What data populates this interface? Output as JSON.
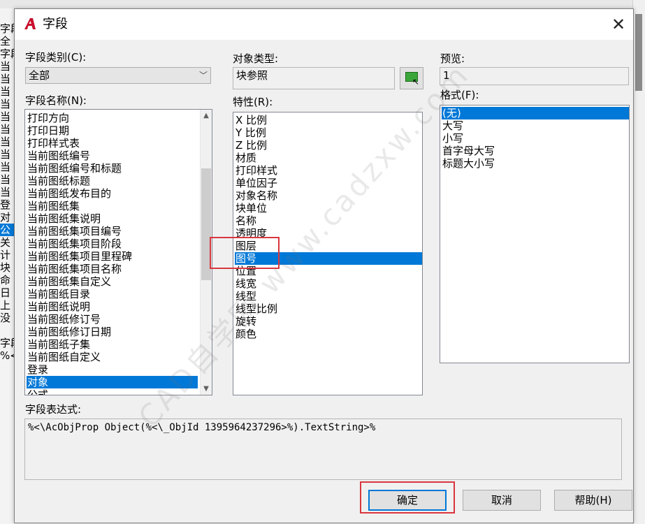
{
  "background_window": {
    "left_items": [
      "字段",
      "全",
      "字段",
      "当",
      "当",
      "当",
      "当",
      "当",
      "当",
      "当",
      "当",
      "当",
      "当",
      "当",
      "登",
      "对",
      "公",
      "关",
      "计",
      "块",
      "命",
      "日",
      "上",
      "没",
      "",
      "字段",
      "%<"
    ],
    "left_selected_index": 16
  },
  "dialog": {
    "title": "字段",
    "close_symbol": "✕",
    "category": {
      "label": "字段类别(C):",
      "value": "全部"
    },
    "field_names": {
      "label": "字段名称(N):",
      "items": [
        "打印方向",
        "打印日期",
        "打印样式表",
        "当前图纸编号",
        "当前图纸编号和标题",
        "当前图纸标题",
        "当前图纸发布目的",
        "当前图纸集",
        "当前图纸集说明",
        "当前图纸集项目编号",
        "当前图纸集项目阶段",
        "当前图纸集项目里程碑",
        "当前图纸集项目名称",
        "当前图纸集自定义",
        "当前图纸目录",
        "当前图纸说明",
        "当前图纸修订号",
        "当前图纸修订日期",
        "当前图纸子集",
        "当前图纸自定义",
        "登录",
        "对象",
        "公式"
      ],
      "selected_index": 21
    },
    "object_type": {
      "label": "对象类型:",
      "value": "块参照"
    },
    "properties": {
      "label": "特性(R):",
      "items": [
        "X 比例",
        "Y 比例",
        "Z 比例",
        "材质",
        "打印样式",
        "单位因子",
        "对象名称",
        "块单位",
        "名称",
        "透明度",
        "图层",
        "图号",
        "位置",
        "线宽",
        "线型",
        "线型比例",
        "旋转",
        "颜色"
      ],
      "selected_index": 11
    },
    "preview": {
      "label": "预览:",
      "value": "1"
    },
    "format": {
      "label": "格式(F):",
      "items": [
        "(无)",
        "大写",
        "小写",
        "首字母大写",
        "标题大小写"
      ],
      "selected_index": 0
    },
    "expression": {
      "label": "字段表达式:",
      "value": "%<\\AcObjProp Object(%<\\_ObjId 1395964237296>%).TextString>%"
    },
    "buttons": {
      "ok": "确定",
      "cancel": "取消",
      "help": "帮助(H)"
    }
  },
  "watermark": "CAD自学网 www.cadzxw.com",
  "colors": {
    "selection": "#0078d7",
    "highlight_box": "#d9363e",
    "dialog_bg": "#f0f0f0",
    "app_icon": "#c8102e"
  }
}
